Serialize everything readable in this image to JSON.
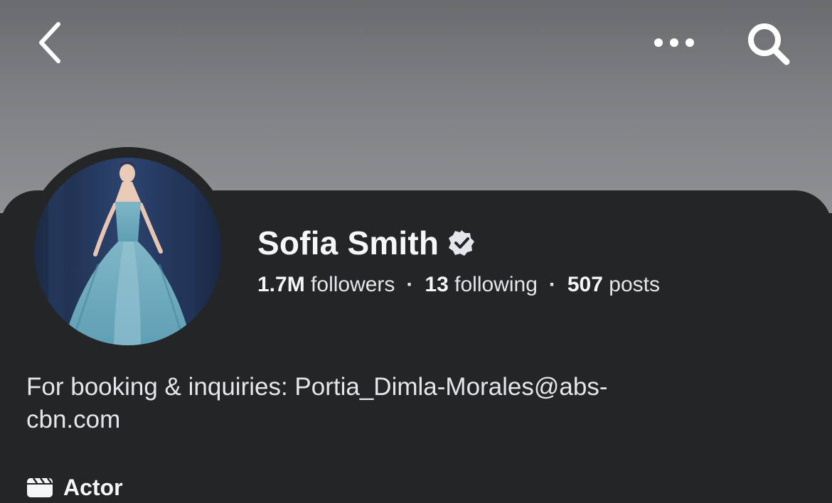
{
  "nav": {
    "back_icon": "chevron-left-icon",
    "more_icon": "ellipsis-icon",
    "search_icon": "search-icon"
  },
  "profile": {
    "name": "Sofia Smith",
    "verified_icon": "verified-badge-icon",
    "followers_count": "1.7M",
    "followers_label": "followers",
    "following_count": "13",
    "following_label": "following",
    "posts_count": "507",
    "posts_label": "posts",
    "separator": "·",
    "bio_line1": "For booking & inquiries: Portia_Dimla-Morales@abs-",
    "bio_line2": "cbn.com",
    "category_icon": "clapperboard-icon",
    "category": "Actor"
  },
  "colors": {
    "background": "#242526",
    "cover_top": "#6a6b6e",
    "cover_bottom": "#909194",
    "text": "#e4e6eb"
  }
}
